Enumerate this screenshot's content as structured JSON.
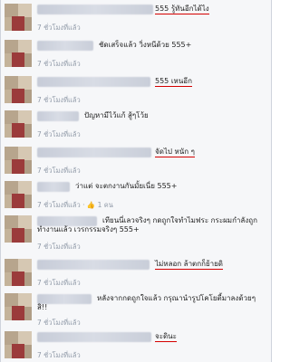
{
  "time_label": "7 ชั่วโมงที่แล้ว",
  "comments": [
    {
      "text": "555 รู้ทันอีกได้ไง",
      "underlined": true
    },
    {
      "text": "ชัดเสร็จแล้ว วิ่งหนีด้วย 555+",
      "underlined": false
    },
    {
      "text": "555 เหนอีก",
      "underlined": true
    },
    {
      "text": "ปัญหามีไว้แก้ สู้ๆโว้ย",
      "underlined": false
    },
    {
      "text": "จัดไป หนัก ๆ",
      "underlined": true
    },
    {
      "text": "ว่าแต่ จะตกงานกันมั้ยเนี่ย 555+",
      "underlined": false,
      "likes": "1 คน"
    },
    {
      "text": "เทียนนี่เลวจริงๆ กดถูกใจทำไมฟระ กระผมกำลังถูก",
      "line2": "ทำงานแล้ว เวรกรรมจริงๆ 555+",
      "underlined": false
    },
    {
      "text": "ไม่หลอก ล้าตกก็ย้ายดิ",
      "underlined": true
    },
    {
      "text": "หลังจากกดถูกใจแล้ว กรุณานำรูปโคโยตี้มาลงด้วยๆ",
      "line2": "สิ!!",
      "underlined": false
    },
    {
      "text": "จะดินะ",
      "underlined": true
    }
  ]
}
